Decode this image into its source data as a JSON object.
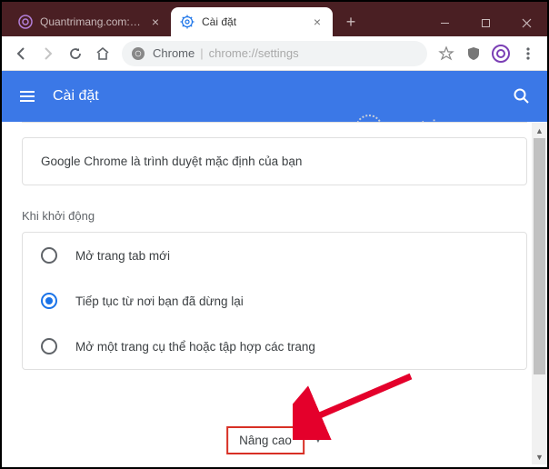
{
  "window": {
    "tabs": [
      {
        "title": "Quantrimang.com: Kiế",
        "favicon": "purple-q"
      },
      {
        "title": "Cài đặt",
        "favicon": "gear-blue"
      }
    ],
    "active_tab_close": "×",
    "inactive_tab_close": "×"
  },
  "toolbar": {
    "url_prefix": "Chrome",
    "url_main": "chrome://settings"
  },
  "header": {
    "title": "Cài đặt"
  },
  "default_browser": {
    "text": "Google Chrome là trình duyệt mặc định của bạn"
  },
  "startup": {
    "title": "Khi khởi động",
    "options": [
      {
        "label": "Mở trang tab mới",
        "checked": false
      },
      {
        "label": "Tiếp tục từ nơi bạn đã dừng lại",
        "checked": true
      },
      {
        "label": "Mở một trang cụ thể hoặc tập hợp các trang",
        "checked": false
      }
    ]
  },
  "advanced": {
    "label": "Nâng cao"
  },
  "watermark": {
    "text": "uantrimang.com"
  }
}
